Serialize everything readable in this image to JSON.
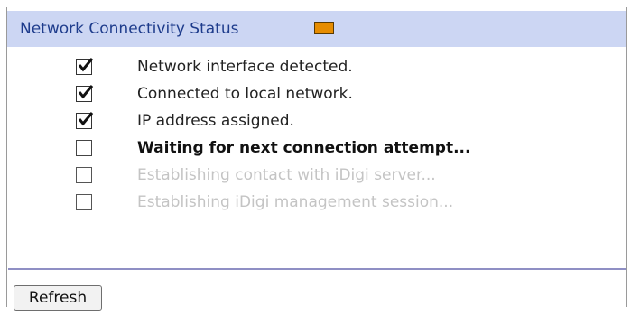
{
  "header": {
    "title": "Network Connectivity Status",
    "status_color": "#e68c00"
  },
  "steps": [
    {
      "label": "Network interface detected.",
      "checked": true,
      "state": "done"
    },
    {
      "label": "Connected to local network.",
      "checked": true,
      "state": "done"
    },
    {
      "label": "IP address assigned.",
      "checked": true,
      "state": "done"
    },
    {
      "label": "Waiting for next connection attempt...",
      "checked": false,
      "state": "active"
    },
    {
      "label": "Establishing contact with iDigi server...",
      "checked": false,
      "state": "pending"
    },
    {
      "label": "Establishing iDigi management session...",
      "checked": false,
      "state": "pending"
    }
  ],
  "actions": {
    "refresh_label": "Refresh"
  }
}
